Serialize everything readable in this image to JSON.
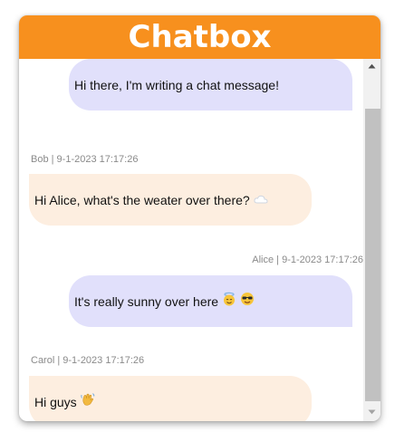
{
  "header": {
    "title": "Chatbox"
  },
  "messages": [
    {
      "sender": "",
      "timestamp": "",
      "meta": "",
      "text": "Hi there, I'm writing a chat message!",
      "type": "sent",
      "emoji": []
    },
    {
      "sender": "Bob",
      "timestamp": "9-1-2023 17:17:26",
      "meta": "Bob | 9-1-2023 17:17:26",
      "text": "Hi Alice, what's the weater over there?",
      "type": "received",
      "emoji": [
        "cloud-emoji"
      ]
    },
    {
      "sender": "Alice",
      "timestamp": "9-1-2023 17:17:26",
      "meta": "Alice | 9-1-2023 17:17:26",
      "text": "It's really sunny over here",
      "type": "sent",
      "emoji": [
        "smiling-face-with-halo-emoji",
        "smiling-face-with-sunglasses-emoji"
      ]
    },
    {
      "sender": "Carol",
      "timestamp": "9-1-2023 17:17:26",
      "meta": "Carol | 9-1-2023 17:17:26",
      "text": "Hi guys",
      "type": "received",
      "emoji": [
        "waving-hand-emoji"
      ]
    }
  ],
  "colors": {
    "header": "#f7901e",
    "sent_bubble": "#e1e0fb",
    "received_bubble": "#fdeee0",
    "meta_text": "#8a8a8a",
    "scroll_thumb": "#c1c1c1"
  }
}
